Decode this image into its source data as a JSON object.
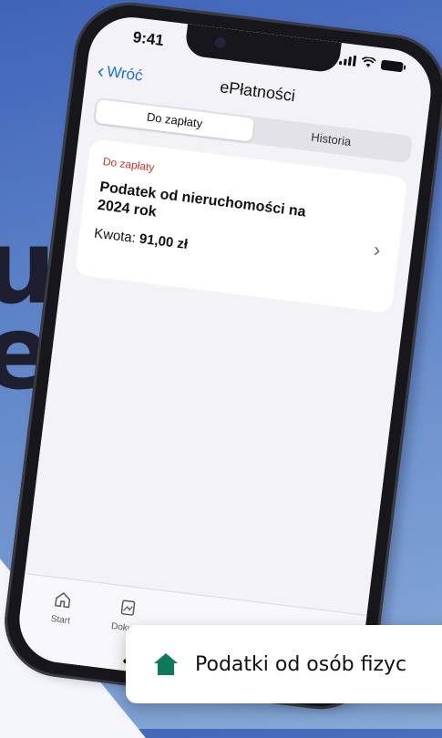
{
  "background": {
    "headline_fragment_1": "u",
    "headline_fragment_2": "el"
  },
  "status_bar": {
    "time": "9:41"
  },
  "nav": {
    "back_label": "Wróć",
    "title": "ePłatności"
  },
  "segmented": {
    "tab_due": "Do zapłaty",
    "tab_history": "Historia",
    "selected": "Do zapłaty"
  },
  "payment_card": {
    "tag": "Do zapłaty",
    "title": "Podatek od nieruchomości na 2024 rok",
    "amount_label": "Kwota:",
    "amount_value": "91,00 zł"
  },
  "tab_bar": {
    "start_label": "Start",
    "documents_label": "Dokum"
  },
  "toast": {
    "text": "Podatki od osób fizyc",
    "icon": "home-icon",
    "icon_color": "#0e7a5a"
  },
  "colors": {
    "accent": "#1b6ef2",
    "due_tag": "#d93025",
    "background": "#5f85c8"
  }
}
